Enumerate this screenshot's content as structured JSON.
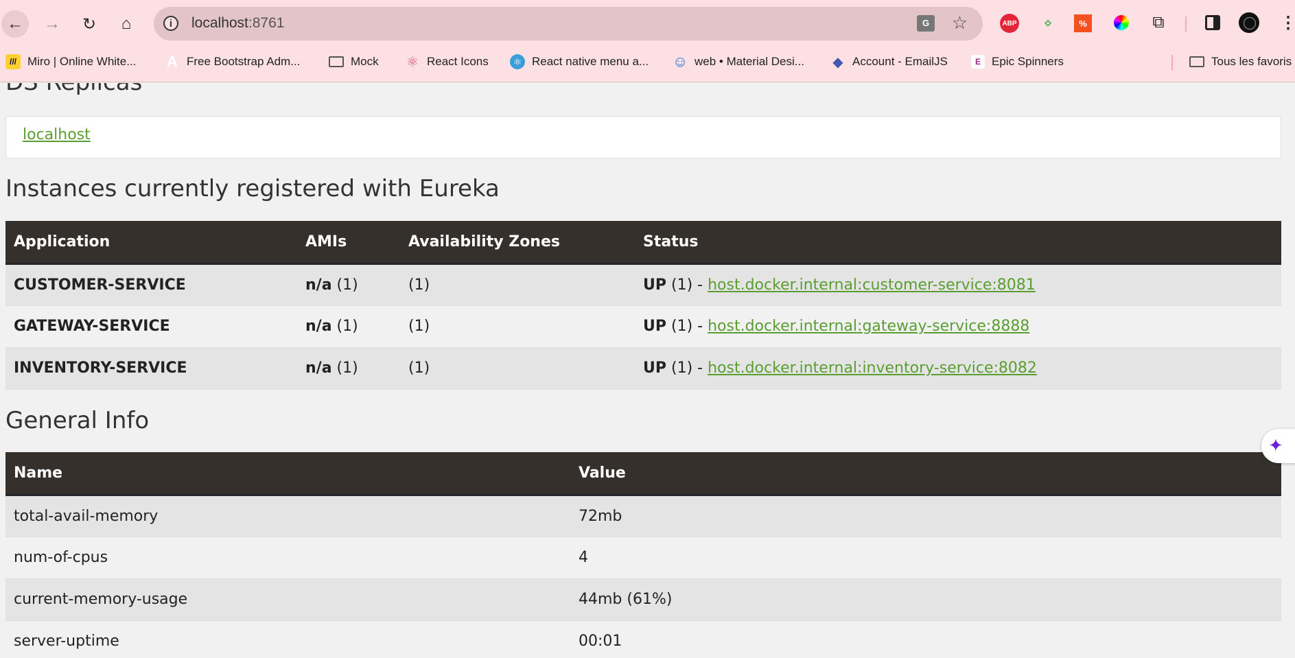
{
  "browser": {
    "url_host": "localhost",
    "url_port": ":8761",
    "icons": {
      "back": "arrow-left-icon",
      "forward": "arrow-right-icon",
      "reload": "reload-icon",
      "home": "home-icon",
      "site_info": "info-icon",
      "translate": "translate-icon",
      "bookmark_star": "star-icon",
      "menu": "more-vert-icon"
    },
    "extensions": [
      {
        "name": "adblock-plus",
        "label": "ABP"
      },
      {
        "name": "arrows-extension",
        "label": "⌃⌄"
      },
      {
        "name": "orange-extension",
        "label": "%"
      },
      {
        "name": "color-picker-extension",
        "label": ""
      },
      {
        "name": "extensions-puzzle",
        "label": ""
      }
    ],
    "bookmarks": [
      {
        "label": "Miro | Online White...",
        "icon": "miro-icon"
      },
      {
        "label": "Free Bootstrap Adm...",
        "icon": "adminlte-icon"
      },
      {
        "label": "Mock",
        "icon": "folder-icon"
      },
      {
        "label": "React Icons",
        "icon": "react-icon"
      },
      {
        "label": "React native menu a...",
        "icon": "react-native-icon"
      },
      {
        "label": "web • Material Desi...",
        "icon": "smiley-icon"
      },
      {
        "label": "Account - EmailJS",
        "icon": "emailjs-icon"
      },
      {
        "label": "Epic Spinners",
        "icon": "epic-spinners-icon"
      }
    ],
    "all_bookmarks_label": "Tous les favoris"
  },
  "page": {
    "partial_heading": "DS Replicas",
    "replica_link": "localhost",
    "instances_heading": "Instances currently registered with Eureka",
    "instances_table": {
      "headers": [
        "Application",
        "AMIs",
        "Availability Zones",
        "Status"
      ],
      "rows": [
        {
          "application": "CUSTOMER-SERVICE",
          "ami_label": "n/a",
          "ami_count": "(1)",
          "zones": "(1)",
          "status_label": "UP",
          "status_count": "(1) -",
          "instance_link": "host.docker.internal:customer-service:8081"
        },
        {
          "application": "GATEWAY-SERVICE",
          "ami_label": "n/a",
          "ami_count": "(1)",
          "zones": "(1)",
          "status_label": "UP",
          "status_count": "(1) -",
          "instance_link": "host.docker.internal:gateway-service:8888"
        },
        {
          "application": "INVENTORY-SERVICE",
          "ami_label": "n/a",
          "ami_count": "(1)",
          "zones": "(1)",
          "status_label": "UP",
          "status_count": "(1) -",
          "instance_link": "host.docker.internal:inventory-service:8082"
        }
      ]
    },
    "general_heading": "General Info",
    "general_table": {
      "headers": [
        "Name",
        "Value"
      ],
      "rows": [
        {
          "name": "total-avail-memory",
          "value": "72mb"
        },
        {
          "name": "num-of-cpus",
          "value": "4"
        },
        {
          "name": "current-memory-usage",
          "value": "44mb (61%)"
        },
        {
          "name": "server-uptime",
          "value": "00:01"
        }
      ]
    }
  },
  "colors": {
    "link": "#5a9e31",
    "table_header": "#35302c",
    "chrome_bg": "#fde0e4",
    "ai_accent": "#6a1ed8"
  }
}
